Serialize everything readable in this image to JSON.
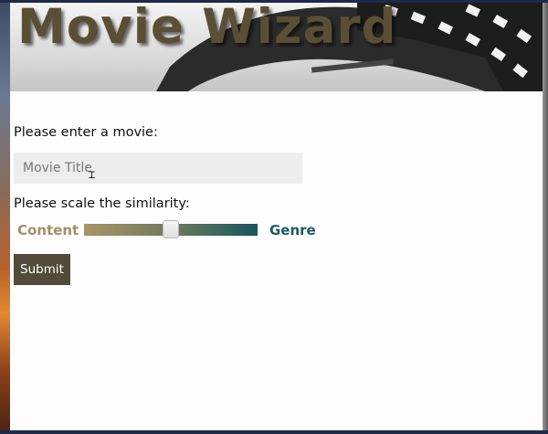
{
  "banner": {
    "title": "Movie Wizard"
  },
  "form": {
    "movie_prompt": "Please enter a movie:",
    "movie_input_placeholder": "Movie Title",
    "movie_input_value": "",
    "scale_prompt": "Please scale the similarity:",
    "slider_left_label": "Content",
    "slider_right_label": "Genre",
    "slider_value_fraction": 0.5,
    "submit_label": "Submit"
  },
  "colors": {
    "content_label": "#a38f69",
    "genre_label": "#1f5a60",
    "submit_background": "#524b3a",
    "banner_title": "#5a4e34",
    "slider_start": "#a9946a",
    "slider_end": "#16565c"
  }
}
